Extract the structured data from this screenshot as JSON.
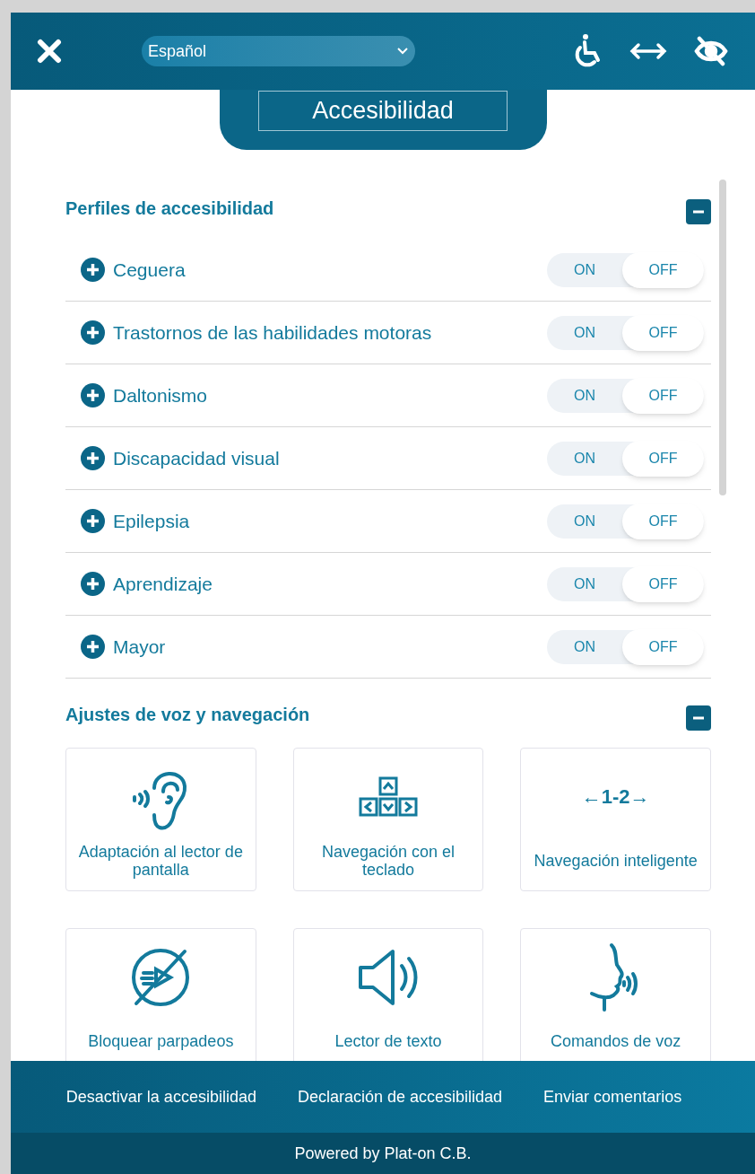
{
  "header": {
    "language": "Español",
    "title": "Accesibilidad"
  },
  "profiles": {
    "title": "Perfiles de accesibilidad",
    "expanded": true,
    "items": [
      {
        "label": "Ceguera",
        "on": false,
        "on_label": "ON",
        "off_label": "OFF"
      },
      {
        "label": "Trastornos de las habilidades motoras",
        "on": false,
        "on_label": "ON",
        "off_label": "OFF"
      },
      {
        "label": "Daltonismo",
        "on": false,
        "on_label": "ON",
        "off_label": "OFF"
      },
      {
        "label": "Discapacidad visual",
        "on": false,
        "on_label": "ON",
        "off_label": "OFF"
      },
      {
        "label": "Epilepsia",
        "on": false,
        "on_label": "ON",
        "off_label": "OFF"
      },
      {
        "label": "Aprendizaje",
        "on": false,
        "on_label": "ON",
        "off_label": "OFF"
      },
      {
        "label": "Mayor",
        "on": false,
        "on_label": "ON",
        "off_label": "OFF"
      }
    ]
  },
  "voice": {
    "title": "Ajustes de voz y navegación",
    "expanded": true,
    "tiles": [
      {
        "kind": "ear",
        "label": "Adaptación al lector de pantalla"
      },
      {
        "kind": "keys",
        "label": "Navegación con el teclado"
      },
      {
        "kind": "glyph",
        "glyph": "←1-2→",
        "label": "Navegación inteligente"
      },
      {
        "kind": "noflash",
        "label": "Bloquear parpadeos"
      },
      {
        "kind": "speaker",
        "label": "Lector de texto"
      },
      {
        "kind": "voice",
        "label": "Comandos de voz"
      }
    ]
  },
  "footer": {
    "links": [
      "Desactivar la accesibilidad",
      "Declaración de accesibilidad",
      "Enviar comentarios"
    ],
    "powered": "Powered by Plat-on C.B."
  }
}
